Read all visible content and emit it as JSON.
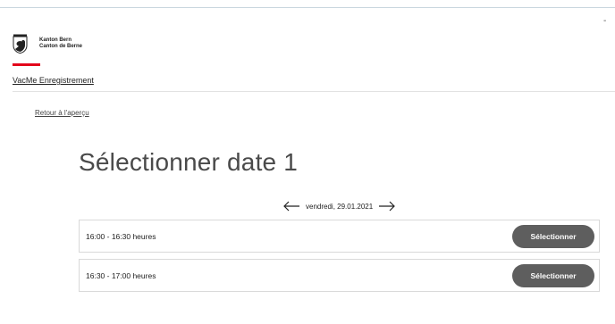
{
  "header": {
    "logo_line1": "Kanton Bern",
    "logo_line2": "Canton de Berne",
    "app_name": "VacMe Enregistrement",
    "top_right_mark": "-"
  },
  "nav": {
    "back_label": "Retour à l'aperçu"
  },
  "main": {
    "title": "Sélectionner date 1",
    "date_label": "vendredi, 29.01.2021",
    "slots": [
      {
        "time": "16:00 - 16:30 heures",
        "button_label": "Sélectionner"
      },
      {
        "time": "16:30 - 17:00 heures",
        "button_label": "Sélectionner"
      }
    ]
  },
  "icons": {
    "prev": "arrow-left-icon",
    "next": "arrow-right-icon",
    "crest": "bern-bear-crest-icon"
  },
  "colors": {
    "accent_red": "#e3001b",
    "button_bg": "#5e5e5e",
    "button_text": "#ffffff",
    "border": "#d9d9d9"
  }
}
